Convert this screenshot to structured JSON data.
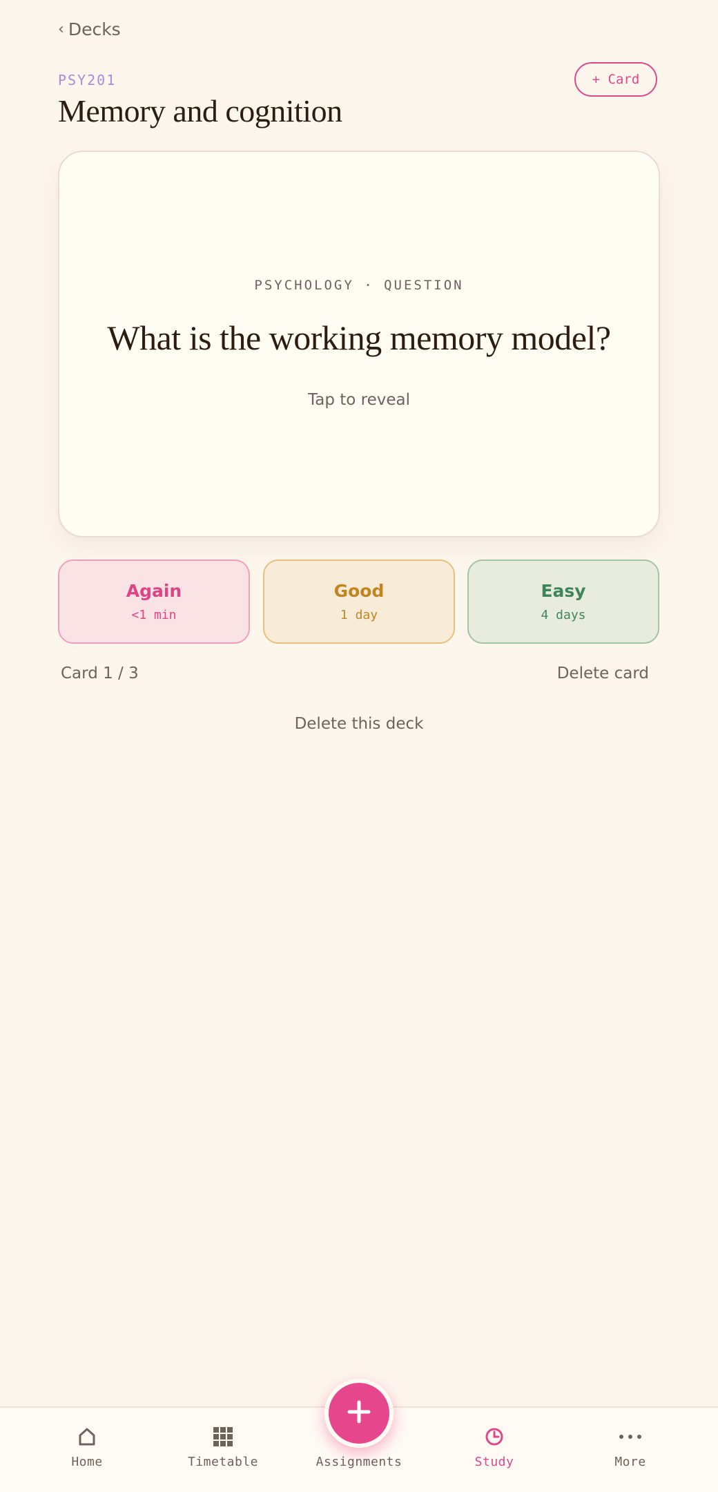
{
  "header": {
    "back_label": "Decks",
    "course_code": "PSY201",
    "deck_title": "Memory and cognition",
    "add_card_label": "+ Card"
  },
  "card": {
    "meta": "PSYCHOLOGY · QUESTION",
    "question": "What is the working memory model?",
    "hint": "Tap to reveal"
  },
  "ratings": [
    {
      "label": "Again",
      "interval": "<1 min",
      "color": "#df4386"
    },
    {
      "label": "Good",
      "interval": "1 day",
      "color": "#c2841f"
    },
    {
      "label": "Easy",
      "interval": "4 days",
      "color": "#3f855a"
    }
  ],
  "footer": {
    "card_counter": "Card 1 / 3",
    "delete_card_label": "Delete card",
    "delete_deck_label": "Delete this deck"
  },
  "nav": {
    "items": [
      {
        "label": "Home",
        "icon": "home-icon"
      },
      {
        "label": "Timetable",
        "icon": "grid-icon"
      },
      {
        "label": "Assignments",
        "icon": "plus-icon"
      },
      {
        "label": "Study",
        "icon": "clock-icon",
        "active": true
      },
      {
        "label": "More",
        "icon": "more-dots-icon"
      }
    ],
    "fab_icon": "plus-icon"
  },
  "colors": {
    "background": "#fdf6ed",
    "accent": "#e6468b",
    "course_code": "#a98bd9"
  }
}
